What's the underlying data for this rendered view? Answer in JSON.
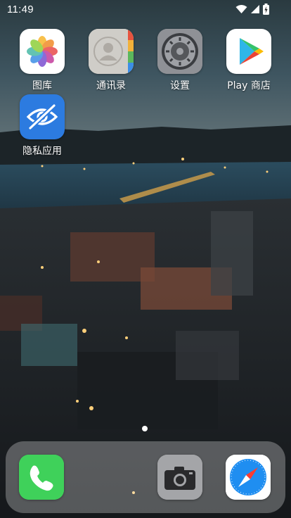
{
  "status_bar": {
    "time": "11:49",
    "icons": [
      "wifi-icon",
      "cellular-signal-icon",
      "battery-charging-icon"
    ]
  },
  "home_apps": [
    {
      "name": "图库",
      "icon": "photos-icon"
    },
    {
      "name": "通讯录",
      "icon": "contacts-icon"
    },
    {
      "name": "设置",
      "icon": "settings-gear-icon"
    },
    {
      "name": "Play 商店",
      "icon": "play-store-icon"
    },
    {
      "name": "隐私应用",
      "icon": "eye-slash-icon"
    }
  ],
  "page_indicator": {
    "pages": 1,
    "current": 1
  },
  "dock": [
    {
      "app": "phone",
      "icon": "phone-icon"
    },
    {
      "app": "camera",
      "icon": "camera-icon"
    },
    {
      "app": "safari",
      "icon": "compass-icon"
    }
  ],
  "colors": {
    "privacy_blue": "#2c7be0",
    "phone_green": "#34c759",
    "safari_blue": "#1f8ef1"
  }
}
